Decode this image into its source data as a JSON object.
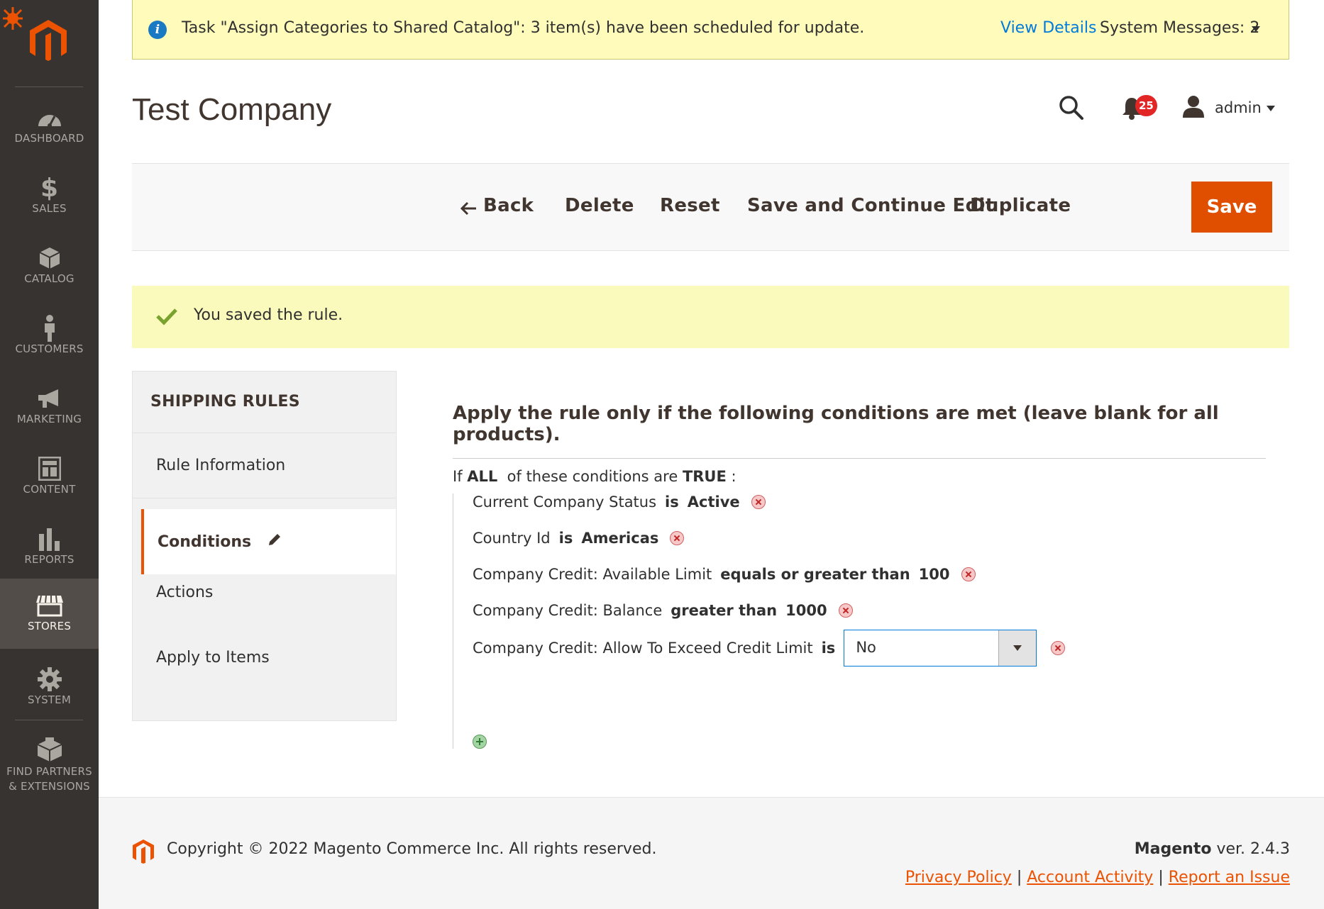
{
  "sidebar": {
    "items": [
      {
        "label": "DASHBOARD",
        "icon": "dashboard-icon"
      },
      {
        "label": "SALES",
        "icon": "dollar-icon"
      },
      {
        "label": "CATALOG",
        "icon": "box-icon"
      },
      {
        "label": "CUSTOMERS",
        "icon": "person-icon"
      },
      {
        "label": "MARKETING",
        "icon": "megaphone-icon"
      },
      {
        "label": "CONTENT",
        "icon": "layout-icon"
      },
      {
        "label": "REPORTS",
        "icon": "bar-chart-icon"
      },
      {
        "label": "STORES",
        "icon": "store-icon"
      },
      {
        "label": "SYSTEM",
        "icon": "gear-icon"
      },
      {
        "label": "FIND PARTNERS & EXTENSIONS",
        "icon": "extensions-icon"
      }
    ],
    "active": "STORES"
  },
  "system_message": {
    "text": "Task \"Assign Categories to Shared Catalog\": 3 item(s) have been scheduled for update.",
    "view_details": "View Details",
    "count_label": "System Messages: 2"
  },
  "header": {
    "title": "Test Company",
    "notifications_count": "25",
    "user": "admin"
  },
  "actions": {
    "back": "Back",
    "delete": "Delete",
    "reset": "Reset",
    "save_continue": "Save and Continue Edit",
    "duplicate": "Duplicate",
    "save": "Save"
  },
  "success_message": "You saved the rule.",
  "tabs": {
    "title": "SHIPPING RULES",
    "items": [
      "Rule Information",
      "Conditions",
      "Actions",
      "Apply to Items"
    ],
    "active": "Conditions"
  },
  "conditions": {
    "heading": "Apply the rule only if the following conditions are met (leave blank for all products).",
    "if_prefix": "If",
    "aggregator": "ALL",
    "if_middle": "of these conditions are",
    "value": "TRUE",
    "if_suffix": ":",
    "rows": [
      {
        "attribute": "Current Company Status",
        "operator": "is",
        "value": "Active"
      },
      {
        "attribute": "Country Id",
        "operator": "is",
        "value": "Americas"
      },
      {
        "attribute": "Company Credit: Available Limit",
        "operator": "equals or greater than",
        "value": "100"
      },
      {
        "attribute": "Company Credit: Balance",
        "operator": "greater than",
        "value": "1000"
      },
      {
        "attribute": "Company Credit: Allow To Exceed Credit Limit",
        "operator": "is",
        "value": "No"
      }
    ]
  },
  "footer": {
    "copyright": "Copyright © 2022 Magento Commerce Inc. All rights reserved.",
    "brand": "Magento",
    "version": "ver. 2.4.3",
    "links": [
      "Privacy Policy",
      " Account Activity",
      "Report an Issue"
    ],
    "separator": "|"
  },
  "colors": {
    "sidebar_bg": "#373330",
    "accent": "#eb5202",
    "save_bg": "#e04f00",
    "link": "#007bdb",
    "notice_bg": "#fffbbb"
  }
}
